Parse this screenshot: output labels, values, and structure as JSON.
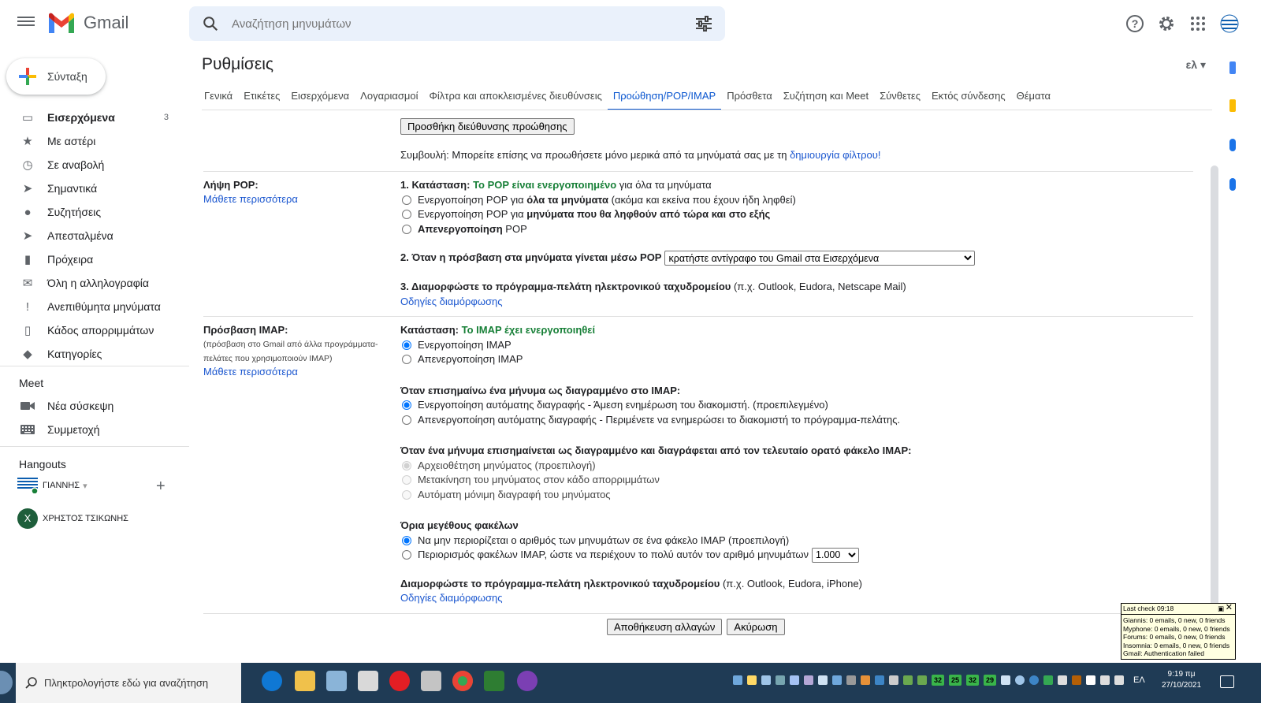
{
  "app": {
    "name": "Gmail",
    "search_placeholder": "Αναζήτηση μηνυμάτων"
  },
  "nav": {
    "compose": "Σύνταξη",
    "items": [
      {
        "label": "Εισερχόμενα",
        "count": "3",
        "icon": "inbox-icon",
        "active": true
      },
      {
        "label": "Με αστέρι",
        "icon": "star-icon"
      },
      {
        "label": "Σε αναβολή",
        "icon": "clock-icon"
      },
      {
        "label": "Σημαντικά",
        "icon": "important-icon"
      },
      {
        "label": "Συζητήσεις",
        "icon": "chat-icon"
      },
      {
        "label": "Απεσταλμένα",
        "icon": "send-icon"
      },
      {
        "label": "Πρόχειρα",
        "icon": "draft-icon"
      },
      {
        "label": "Όλη η αλληλογραφία",
        "icon": "mail-icon"
      },
      {
        "label": "Ανεπιθύμητα μηνύματα",
        "icon": "spam-icon"
      },
      {
        "label": "Κάδος απορριμμάτων",
        "icon": "trash-icon"
      },
      {
        "label": "Κατηγορίες",
        "icon": "label-icon"
      }
    ],
    "meet": {
      "title": "Meet",
      "new_meeting": "Νέα σύσκεψη",
      "join": "Συμμετοχή"
    },
    "hangouts": {
      "title": "Hangouts",
      "me": "ΓΙΑΝΝΗΣ",
      "contact": "ΧΡΗΣΤΟΣ ΤΣΙΚΩΝΗΣ",
      "contact_initial": "Χ"
    }
  },
  "settings": {
    "title": "Ρυθμίσεις",
    "lang": "ελ",
    "tabs": [
      "Γενικά",
      "Ετικέτες",
      "Εισερχόμενα",
      "Λογαριασμοί",
      "Φίλτρα και αποκλεισμένες διευθύνσεις",
      "Προώθηση/POP/IMAP",
      "Πρόσθετα",
      "Συζήτηση και Meet",
      "Σύνθετες",
      "Εκτός σύνδεσης",
      "Θέματα"
    ],
    "active_tab": 5,
    "forward": {
      "add_button": "Προσθήκη διεύθυνσης προώθησης",
      "tip": "Συμβουλή: Μπορείτε επίσης να προωθήσετε μόνο μερικά από τα μηνύματά σας με τη ",
      "tip_link": "δημιουργία φίλτρου!"
    },
    "pop": {
      "label": "Λήψη POP:",
      "learn_more": "Μάθετε περισσότερα",
      "status_prefix": "1. Κατάσταση: ",
      "status": "Το POP είναι ενεργοποιημένο",
      "status_suffix": " για όλα τα μηνύματα",
      "options": [
        {
          "pre": "Ενεργοποίηση POP για ",
          "bold": "όλα τα μηνύματα",
          "post": " (ακόμα και εκείνα που έχουν ήδη ληφθεί)"
        },
        {
          "pre": "Ενεργοποίηση POP για ",
          "bold": "μηνύματα που θα ληφθούν από τώρα και στο εξής",
          "post": ""
        },
        {
          "pre": "",
          "bold": "Απενεργοποίηση",
          "post": " POP"
        }
      ],
      "access_label": "2. Όταν η πρόσβαση στα μηνύματα γίνεται μέσω POP",
      "access_select": "κρατήστε αντίγραφο του Gmail στα Εισερχόμενα",
      "config_label": "3. Διαμορφώστε το πρόγραμμα-πελάτη ηλεκτρονικού ταχυδρομείου",
      "config_suffix": " (π.χ. Outlook, Eudora, Netscape Mail)",
      "config_link": "Οδηγίες διαμόρφωσης"
    },
    "imap": {
      "label": "Πρόσβαση IMAP:",
      "sub": "(πρόσβαση στο Gmail από άλλα προγράμματα-πελάτες που χρησιμοποιούν IMAP)",
      "learn_more": "Μάθετε περισσότερα",
      "status_prefix": "Κατάσταση: ",
      "status": "Το IMAP έχει ενεργοποιηθεί",
      "enable": "Ενεργοποίηση IMAP",
      "disable": "Απενεργοποίηση IMAP",
      "deleted_title": "Όταν επισημαίνω ένα μήνυμα ως διαγραμμένο στο IMAP:",
      "deleted_opts": [
        "Ενεργοποίηση αυτόματης διαγραφής - Άμεση ενημέρωση του διακομιστή. (προεπιλεγμένο)",
        "Απενεργοποίηση αυτόματης διαγραφής - Περιμένετε να ενημερώσει το διακομιστή το πρόγραμμα-πελάτης."
      ],
      "expunge_title": "Όταν ένα μήνυμα επισημαίνεται ως διαγραμμένο και διαγράφεται από τον τελευταίο ορατό φάκελο IMAP:",
      "expunge_opts": [
        "Αρχειοθέτηση μηνύματος (προεπιλογή)",
        "Μετακίνηση του μηνύματος στον κάδο απορριμμάτων",
        "Αυτόματη μόνιμη διαγραφή του μηνύματος"
      ],
      "folder_title": "Όρια μεγέθους φακέλων",
      "folder_opts": [
        "Να μην περιορίζεται ο αριθμός των μηνυμάτων σε ένα φάκελο IMAP (προεπιλογή)",
        "Περιορισμός φακέλων IMAP, ώστε να περιέχουν το πολύ αυτόν τον αριθμό μηνυμάτων"
      ],
      "folder_select": "1.000",
      "config_label": "Διαμορφώστε το πρόγραμμα-πελάτη ηλεκτρονικού ταχυδρομείου",
      "config_suffix": " (π.χ. Outlook, Eudora, iPhone)",
      "config_link": "Οδηγίες διαμόρφωσης"
    },
    "save": "Αποθήκευση αλλαγών",
    "cancel": "Ακύρωση"
  },
  "notif": {
    "head": "Last check 09:18",
    "lines": [
      "Giannis: 0 emails, 0 new, 0 friends",
      "Myphone: 0 emails, 0 new, 0 friends",
      "Forums: 0 emails, 0 new, 0 friends",
      "Insomnia: 0 emails, 0 new, 0 friends",
      "Gmail: Authentication failed"
    ]
  },
  "taskbar": {
    "search": "Πληκτρολογήστε εδώ για αναζήτηση",
    "lang": "ΕΛ",
    "time": "9:19 πμ",
    "date": "27/10/2021",
    "tray_nums": [
      "32",
      "25",
      "32",
      "29"
    ]
  },
  "colors": {
    "accent": "#0b57d0",
    "link": "#1a56cf",
    "green": "#188038",
    "taskbar": "#1f3b55"
  }
}
